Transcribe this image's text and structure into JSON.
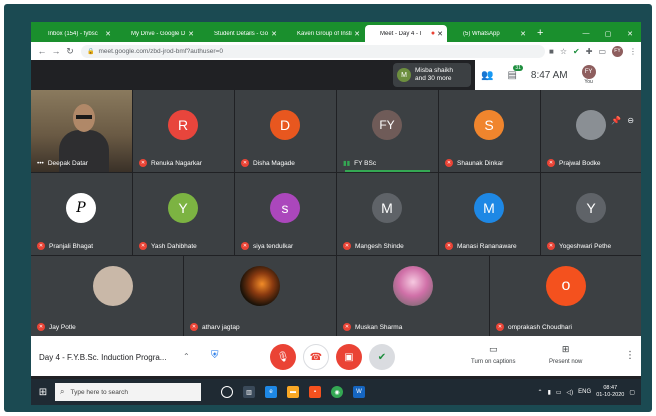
{
  "tabs": [
    {
      "label": "Inbox (154) - fybsc",
      "color": "#ea4335",
      "active": false
    },
    {
      "label": "My Drive - Google D",
      "color": "#fbbc04",
      "active": false
    },
    {
      "label": "Student Details - Go",
      "color": "#34a853",
      "active": false
    },
    {
      "label": "Kaveri Group of Insti",
      "color": "#4285f4",
      "active": false
    },
    {
      "label": "Meet - Day 4 - I",
      "color": "#00897b",
      "active": true
    },
    {
      "label": "(5) WhatsApp",
      "color": "#25d366",
      "active": false
    }
  ],
  "newtab": "+",
  "addressbar": {
    "url": "meet.google.com/zbd-jrod-bmf?authuser=0"
  },
  "profile_initials": "FY",
  "header": {
    "participant_summary_initial": "M",
    "participant_summary_line1": "Misba shaikh",
    "participant_summary_line2": "and 30 more",
    "chat_badge": "31",
    "time": "8:47 AM",
    "you_label": "You",
    "you_initials": "FY"
  },
  "tiles": [
    {
      "name": "Deepak Datar",
      "type": "video",
      "mic": "dots"
    },
    {
      "name": "Renuka Nagarkar",
      "initial": "R",
      "color": "#e8453c",
      "mic": "muted"
    },
    {
      "name": "Disha Magade",
      "initial": "D",
      "color": "#e8571f",
      "mic": "muted"
    },
    {
      "name": "FY BSc",
      "initial": "FY",
      "color": "#6f5b58",
      "mic": "speaking"
    },
    {
      "name": "Shaunak Dinkar",
      "initial": "S",
      "color": "#f0852d",
      "mic": "muted"
    },
    {
      "name": "Prajwal Bodke",
      "type": "photo",
      "color": "#8a8f94",
      "mic": "muted"
    },
    {
      "name": "Pranjali Bhagat",
      "initial": "P",
      "color": "#ffffff",
      "text_color": "#000000",
      "mic": "muted"
    },
    {
      "name": "Yash Dahibhate",
      "initial": "Y",
      "color": "#7cb342",
      "mic": "muted"
    },
    {
      "name": "siya tendulkar",
      "initial": "s",
      "color": "#ab47bc",
      "mic": "muted"
    },
    {
      "name": "Mangesh Shinde",
      "initial": "M",
      "color": "#5f6368",
      "mic": "muted"
    },
    {
      "name": "Manasi Rananaware",
      "initial": "M",
      "color": "#1e88e5",
      "mic": "muted"
    },
    {
      "name": "Yogeshwari Pethe",
      "initial": "Y",
      "color": "#5f6368",
      "mic": "muted"
    },
    {
      "name": "Jay Potle",
      "type": "photo",
      "color": "#c9b8a8",
      "mic": "muted"
    },
    {
      "name": "atharv jagtap",
      "type": "photo",
      "color": "#3a2a18",
      "mic": "muted"
    },
    {
      "name": "Muskan Sharma",
      "type": "photo",
      "color": "#d8a0c0",
      "mic": "muted"
    },
    {
      "name": "omprakash Choudhari",
      "initial": "o",
      "color": "#f4511e",
      "mic": "muted"
    }
  ],
  "meeting": {
    "title": "Day 4 - F.Y.B.Sc. Induction Progra..."
  },
  "controls": {
    "captions_label": "Turn on captions",
    "present_label": "Present now"
  },
  "taskbar": {
    "search_placeholder": "Type here to search",
    "language": "ENG",
    "time": "08:47",
    "date": "01-10-2020"
  }
}
